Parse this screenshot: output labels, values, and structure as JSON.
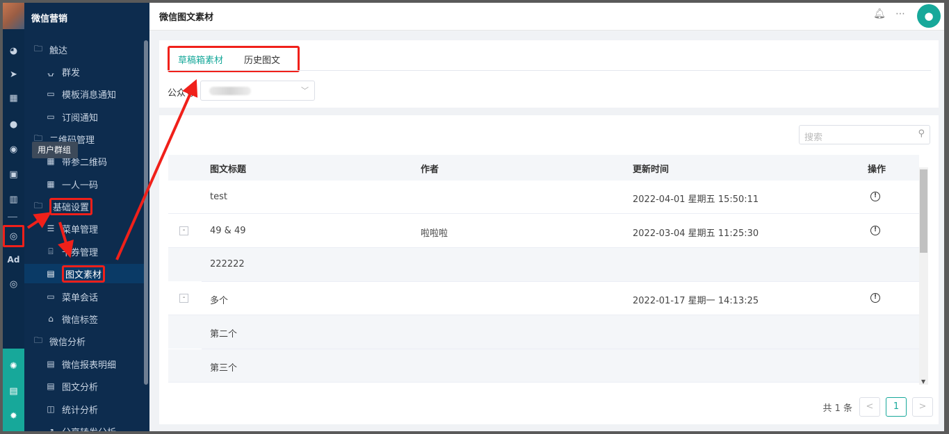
{
  "app": {
    "brand": "微信营销"
  },
  "header": {
    "title": "微信图文素材"
  },
  "tooltip": "用户群组",
  "rail": {
    "icons": [
      "dashboard-icon",
      "send-icon",
      "layout-icon",
      "user-icon",
      "user-group-icon",
      "bookmark-icon",
      "bar-chart-icon",
      "wechat-icon",
      "ad-icon",
      "compass-icon",
      "hub-icon",
      "server-icon",
      "settings-icon"
    ],
    "ad_label": "Ad"
  },
  "sidebar": {
    "items": [
      {
        "label": "触达",
        "type": "group"
      },
      {
        "label": "群发",
        "type": "sub"
      },
      {
        "label": "模板消息通知",
        "type": "sub"
      },
      {
        "label": "订阅通知",
        "type": "sub"
      },
      {
        "label": "二维码管理",
        "type": "group"
      },
      {
        "label": "带参二维码",
        "type": "sub"
      },
      {
        "label": "一人一码",
        "type": "sub"
      },
      {
        "label": "基础设置",
        "type": "group"
      },
      {
        "label": "菜单管理",
        "type": "sub"
      },
      {
        "label": "卡券管理",
        "type": "sub"
      },
      {
        "label": "图文素材",
        "type": "sub",
        "active": true
      },
      {
        "label": "菜单会话",
        "type": "sub"
      },
      {
        "label": "微信标签",
        "type": "sub"
      },
      {
        "label": "微信分析",
        "type": "group"
      },
      {
        "label": "微信报表明细",
        "type": "sub"
      },
      {
        "label": "图文分析",
        "type": "sub"
      },
      {
        "label": "统计分析",
        "type": "sub"
      },
      {
        "label": "分享转发分析",
        "type": "sub"
      }
    ]
  },
  "tabs": [
    {
      "label": "草稿箱素材",
      "active": true
    },
    {
      "label": "历史图文",
      "active": false
    }
  ],
  "filter": {
    "account_label": "公众号"
  },
  "search": {
    "placeholder": "搜索"
  },
  "table": {
    "columns": [
      "图文标题",
      "作者",
      "更新时间",
      "操作"
    ],
    "rows": [
      {
        "title": "test",
        "author": "",
        "time": "2022-04-01 星期五 15:50:11",
        "expand": false,
        "child": false,
        "op": true
      },
      {
        "title": "49 & 49",
        "author": "啦啦啦",
        "time": "2022-03-04 星期五 11:25:30",
        "expand": true,
        "child": false,
        "op": true
      },
      {
        "title": "222222",
        "author": "",
        "time": "",
        "expand": false,
        "child": true,
        "op": false
      },
      {
        "title": "多个",
        "author": "",
        "time": "2022-01-17 星期一 14:13:25",
        "expand": true,
        "child": false,
        "op": true
      },
      {
        "title": "第二个",
        "author": "",
        "time": "",
        "expand": false,
        "child": true,
        "op": false
      },
      {
        "title": "第三个",
        "author": "",
        "time": "",
        "expand": false,
        "child": true,
        "op": false
      }
    ]
  },
  "pagination": {
    "total_label": "共 1 条",
    "current_page": "1",
    "prev": "<",
    "next": ">"
  },
  "colors": {
    "accent": "#17a89a",
    "sidebar": "#0d2c4e",
    "annotation": "#f0201a"
  }
}
